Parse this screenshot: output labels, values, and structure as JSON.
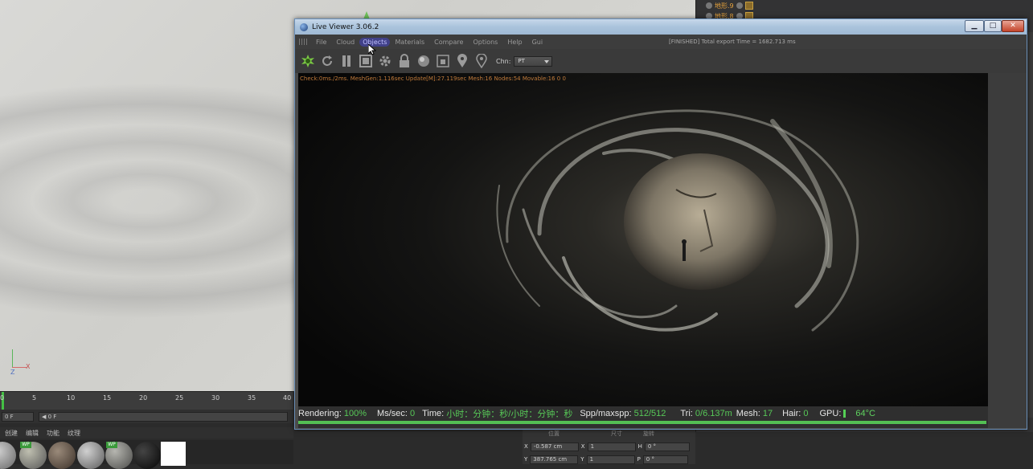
{
  "background_app": {
    "timeline_ticks": [
      "0",
      "5",
      "10",
      "15",
      "20",
      "25",
      "30",
      "35",
      "40"
    ],
    "frame_left": "0 F",
    "frame_field": "◀ 0 F",
    "material_tabs": [
      "创建",
      "编辑",
      "功能",
      "纹理"
    ],
    "material_tags": [
      "WP",
      "WP"
    ],
    "object_rows": [
      "地形.9",
      "地形.8"
    ],
    "coords": {
      "headers": [
        "位置",
        "尺寸",
        "旋转"
      ],
      "x_label": "X",
      "x_value": "-0.587 cm",
      "y_label": "Y",
      "y_value": "387.765 cm",
      "sx_label": "X",
      "sx_value": "1",
      "sy_label": "Y",
      "sy_value": "1",
      "h_label": "H",
      "h_value": "0 °",
      "p_label": "P",
      "p_value": "0 °"
    }
  },
  "live_viewer": {
    "title": "Live Viewer 3.06.2",
    "menu": [
      "File",
      "Cloud",
      "Objects",
      "Materials",
      "Compare",
      "Options",
      "Help",
      "Gui"
    ],
    "status": "[FINISHED] Total export Time = 1682.713 ms",
    "chn_label": "Chn:",
    "chn_value": "PT",
    "debug_line": "Check:0ms./2ms. MeshGen:1.116sec Update[M]:27.119sec Mesh:16 Nodes:54 Movable:16  0 0",
    "stats": {
      "rendering_label": "Rendering:",
      "rendering_value": "100%",
      "ms_label": "Ms/sec:",
      "ms_value": "0",
      "time_label": "Time:",
      "time_value": "小时：分钟：秒/小时：分钟：秒",
      "spp_label": "Spp/maxspp:",
      "spp_value": "512/512",
      "tri_label": "Tri:",
      "tri_value": "0/6.137m",
      "mesh_label": "Mesh:",
      "mesh_value": "17",
      "hair_label": "Hair:",
      "hair_value": "0",
      "gpu_label": "GPU:",
      "gpu_temp": "64°C"
    },
    "progress_fraction": 1.0,
    "accent_green": "#57c857"
  }
}
